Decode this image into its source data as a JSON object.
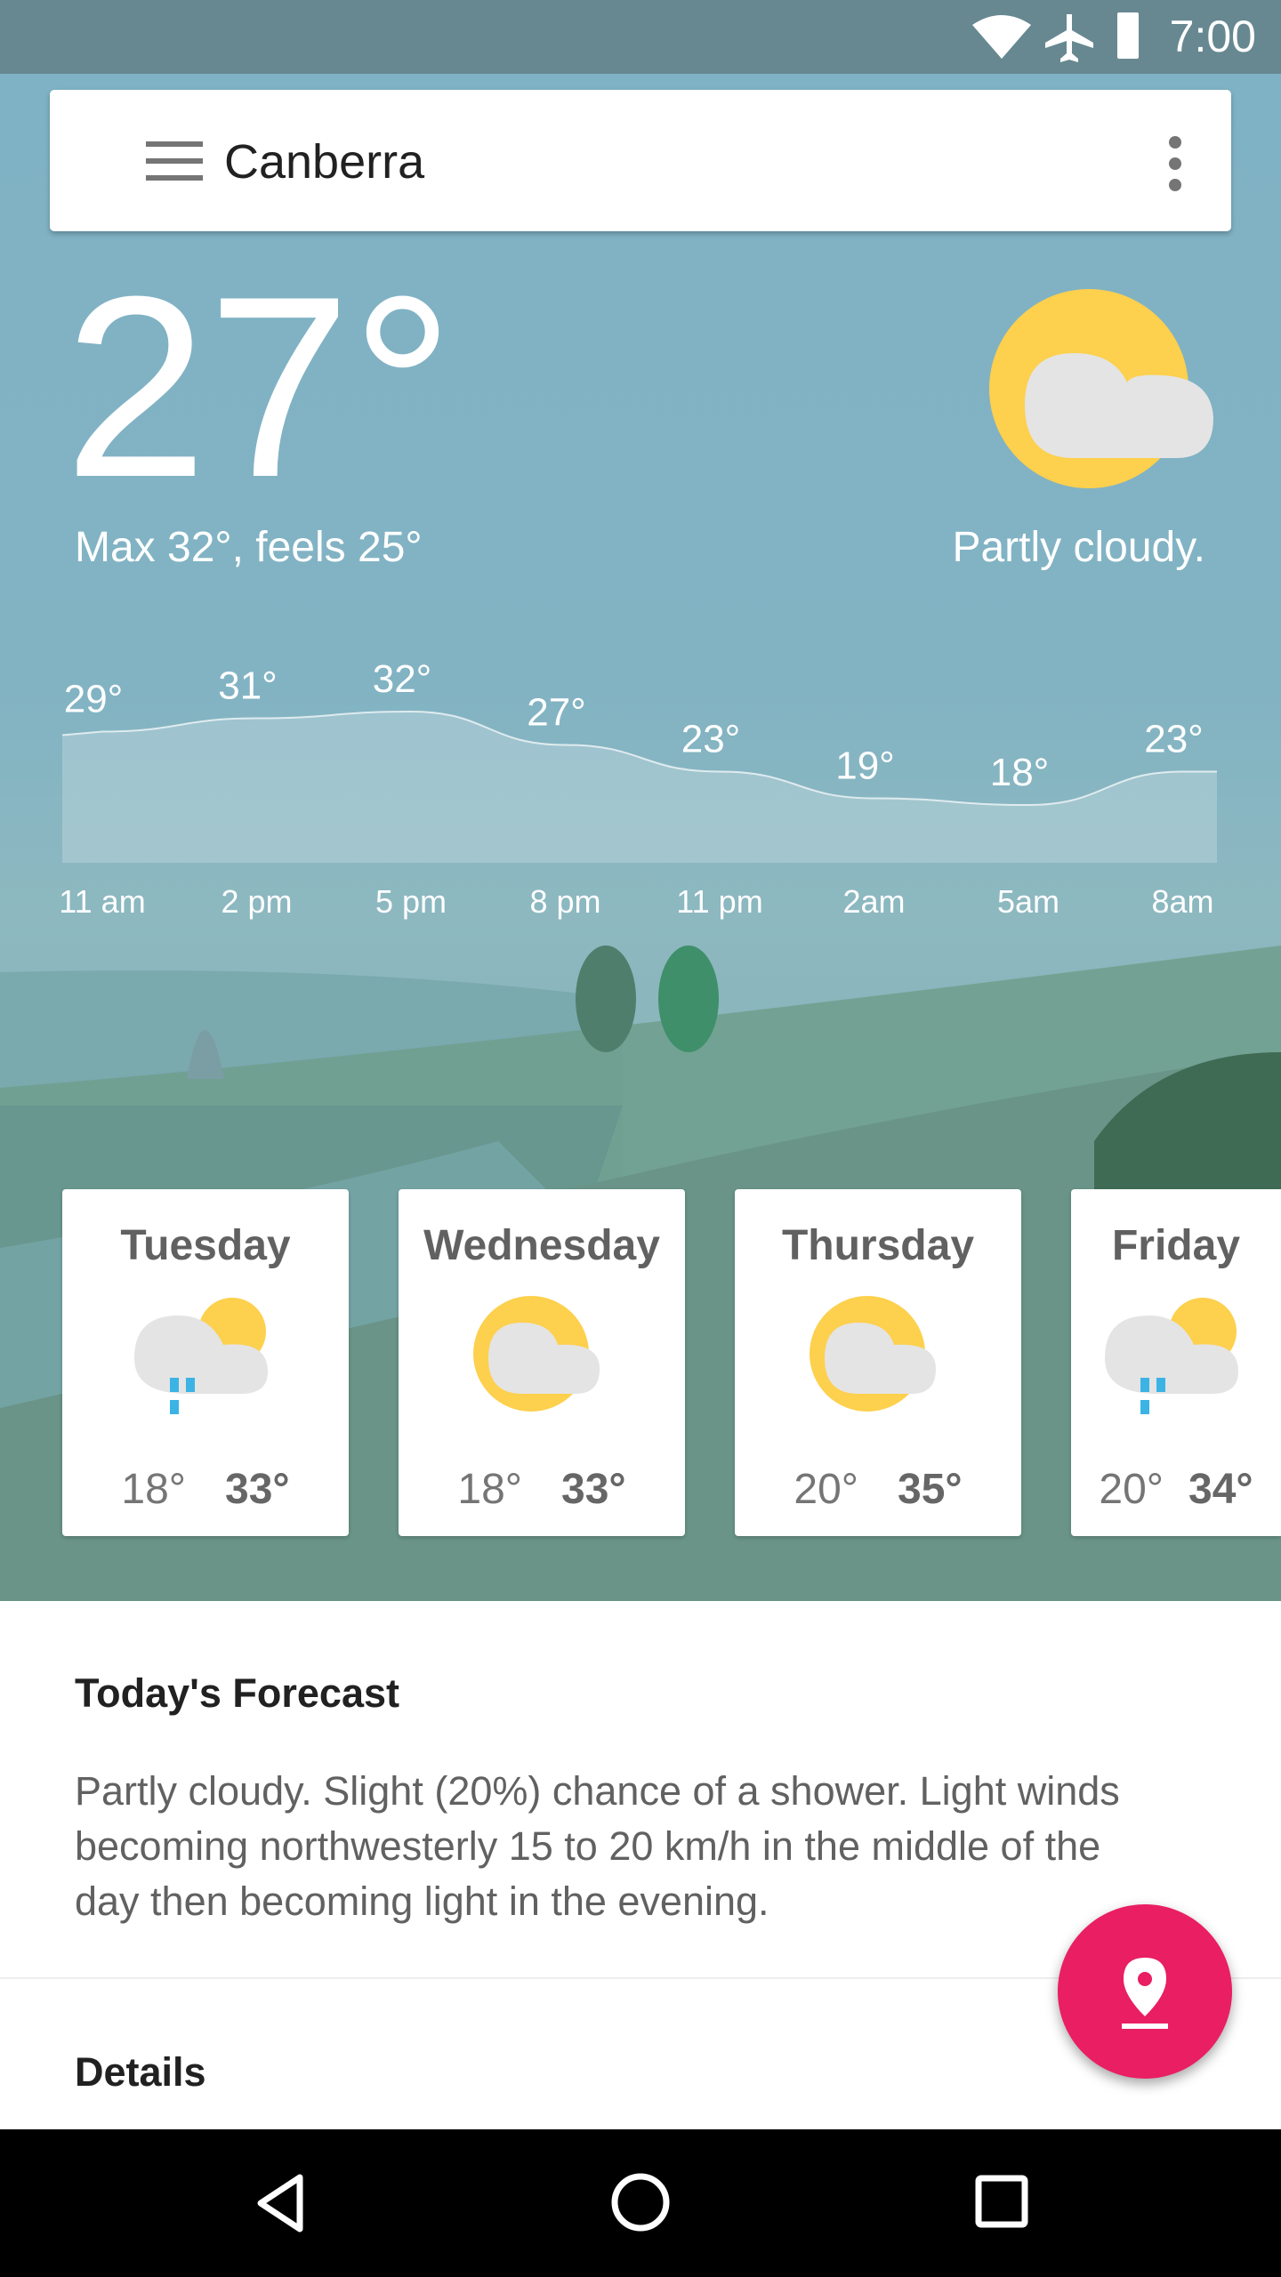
{
  "status_bar": {
    "time": "7:00",
    "icons": [
      "wifi-icon",
      "airplane-icon",
      "battery-icon"
    ]
  },
  "search_bar": {
    "location": "Canberra",
    "menu_icon": "menu-icon",
    "more_icon": "more-vert-icon"
  },
  "current": {
    "temperature": "27°",
    "max_feels": "Max 32°, feels 25°",
    "condition": "Partly cloudy.",
    "icon": "partly-cloudy-icon"
  },
  "hourly": {
    "times": [
      "11 am",
      "2 pm",
      "5 pm",
      "8 pm",
      "11 pm",
      "2am",
      "5am",
      "8am"
    ],
    "temps": [
      "29°",
      "31°",
      "32°",
      "27°",
      "23°",
      "19°",
      "18°",
      "23°"
    ],
    "values": [
      29,
      31,
      32,
      27,
      23,
      19,
      18,
      23
    ]
  },
  "daily": [
    {
      "day": "Tuesday",
      "low": "18°",
      "high": "33°",
      "icon": "shower-partly-cloudy-icon"
    },
    {
      "day": "Wednesday",
      "low": "18°",
      "high": "33°",
      "icon": "partly-cloudy-icon"
    },
    {
      "day": "Thursday",
      "low": "20°",
      "high": "35°",
      "icon": "partly-cloudy-icon"
    },
    {
      "day": "Friday",
      "low": "20°",
      "high": "34°",
      "icon": "shower-partly-cloudy-icon"
    }
  ],
  "forecast": {
    "title": "Today's Forecast",
    "body": "Partly cloudy. Slight (20%) chance of a shower. Light winds becoming northwesterly 15 to 20 km/h in the middle of the day then becoming light in the evening."
  },
  "details": {
    "title": "Details"
  },
  "fab": {
    "icon": "location-pin-icon"
  },
  "colors": {
    "accent": "#e91e63",
    "sun": "#fdd04d",
    "cloud": "#e4e4e4",
    "rain": "#3bb4e5",
    "status_bar": "#678891"
  }
}
